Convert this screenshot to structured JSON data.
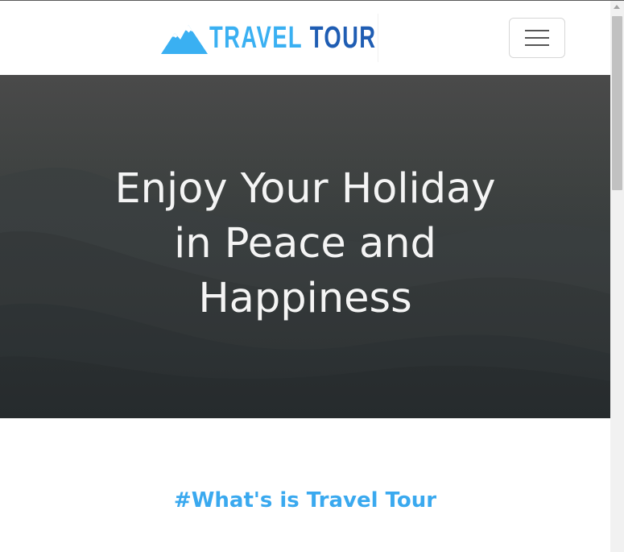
{
  "navbar": {
    "brand_word_1": "TRAVEL",
    "brand_word_2": "TOUR",
    "toggler_icon": "hamburger-menu-icon",
    "colors": {
      "brand_light": "#3ab0f2",
      "brand_dark": "#1f5db3"
    }
  },
  "hero": {
    "title_lines": [
      "Enjoy Your Holiday",
      "in Peace and",
      "Happiness"
    ],
    "background_icon": "mountain-landscape-image"
  },
  "about": {
    "heading": "#What's is Travel Tour",
    "color": "#3aa9ef"
  },
  "scrollbar": {
    "arrow_icon": "scroll-up-arrow-icon"
  }
}
